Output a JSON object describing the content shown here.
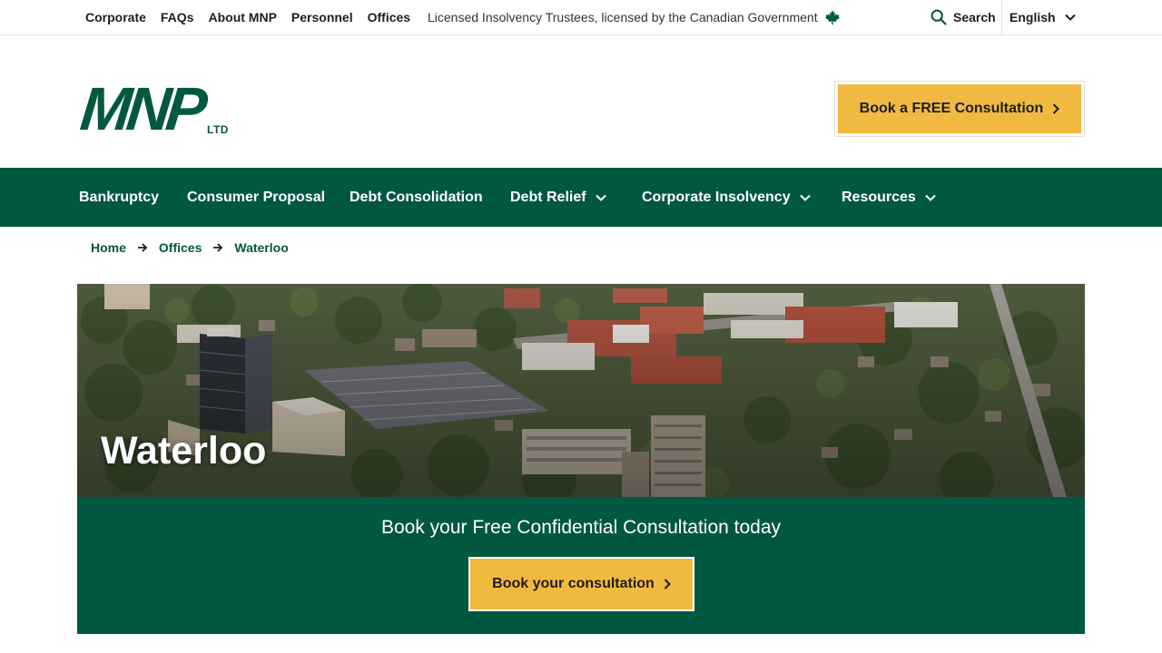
{
  "utility": {
    "links": [
      "Corporate",
      "FAQs",
      "About MNP",
      "Personnel",
      "Offices"
    ],
    "license_note": "Licensed Insolvency Trustees, licensed by the Canadian Government",
    "search_label": "Search",
    "language": "English"
  },
  "logo": {
    "mark": "MNP",
    "sub": "LTD"
  },
  "header": {
    "cta_label": "Book a FREE Consultation"
  },
  "nav": {
    "items": [
      {
        "label": "Bankruptcy",
        "dropdown": false
      },
      {
        "label": "Consumer Proposal",
        "dropdown": false
      },
      {
        "label": "Debt Consolidation",
        "dropdown": false
      },
      {
        "label": "Debt Relief",
        "dropdown": true
      },
      {
        "label": "Corporate Insolvency",
        "dropdown": true
      },
      {
        "label": "Resources",
        "dropdown": true
      }
    ]
  },
  "breadcrumb": [
    "Home",
    "Offices",
    "Waterloo"
  ],
  "hero": {
    "title": "Waterloo"
  },
  "cta_band": {
    "text": "Book your Free Confidential Consultation today",
    "button_label": "Book your consultation"
  },
  "colors": {
    "brand_green": "#005840",
    "accent_yellow": "#f2b940"
  }
}
